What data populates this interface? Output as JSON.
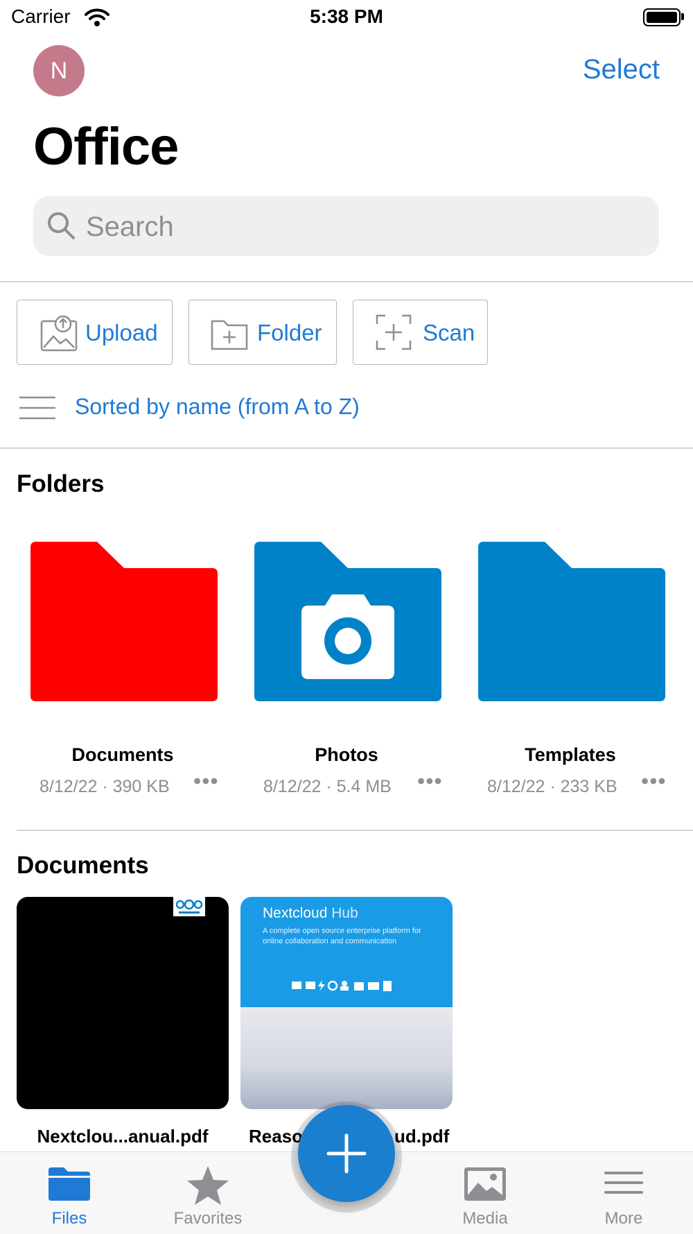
{
  "status_bar": {
    "carrier": "Carrier",
    "time": "5:38 PM"
  },
  "header": {
    "avatar_initial": "N",
    "select_label": "Select",
    "title": "Office"
  },
  "search": {
    "placeholder": "Search",
    "value": ""
  },
  "actions": [
    {
      "label": "Upload",
      "icon": "upload-photo-icon"
    },
    {
      "label": "Folder",
      "icon": "new-folder-icon"
    },
    {
      "label": "Scan",
      "icon": "scan-icon"
    }
  ],
  "sort": {
    "label": "Sorted by name (from A to Z)",
    "icon": "menu-lines-icon"
  },
  "folders_section": {
    "title": "Folders",
    "items": [
      {
        "name": "Documents",
        "meta": "8/12/22 · 390 KB",
        "color": "#ff0000",
        "icon": "folder-icon"
      },
      {
        "name": "Photos",
        "meta": "8/12/22 · 5.4 MB",
        "color": "#0082c9",
        "icon": "folder-camera-icon"
      },
      {
        "name": "Templates",
        "meta": "8/12/22 · 233 KB",
        "color": "#0082c9",
        "icon": "folder-icon"
      }
    ],
    "more_glyph": "•••"
  },
  "documents_section": {
    "title": "Documents",
    "items": [
      {
        "name": "Nextclou...anual.pdf",
        "thumb": "black-pdf-thumbnail"
      },
      {
        "name": "Reaso",
        "name_tail": "ud.pdf",
        "thumb": "nextcloud-hub-thumbnail",
        "thumb_title": "Nextcloud",
        "thumb_title_light": "Hub",
        "thumb_desc": "A complete open source enterprise platform for online collaboration and communication"
      }
    ]
  },
  "fab": {
    "icon": "plus-icon"
  },
  "tabs": [
    {
      "label": "Files",
      "icon": "folder-tab-icon",
      "active": true
    },
    {
      "label": "Favorites",
      "icon": "star-icon",
      "active": false
    },
    {
      "label": "Media",
      "icon": "image-icon",
      "active": false
    },
    {
      "label": "More",
      "icon": "menu-icon",
      "active": false
    }
  ],
  "colors": {
    "accent": "#1f7ad6",
    "folder_blue": "#0082c9",
    "folder_red": "#ff0000",
    "avatar": "#c47a8a"
  }
}
